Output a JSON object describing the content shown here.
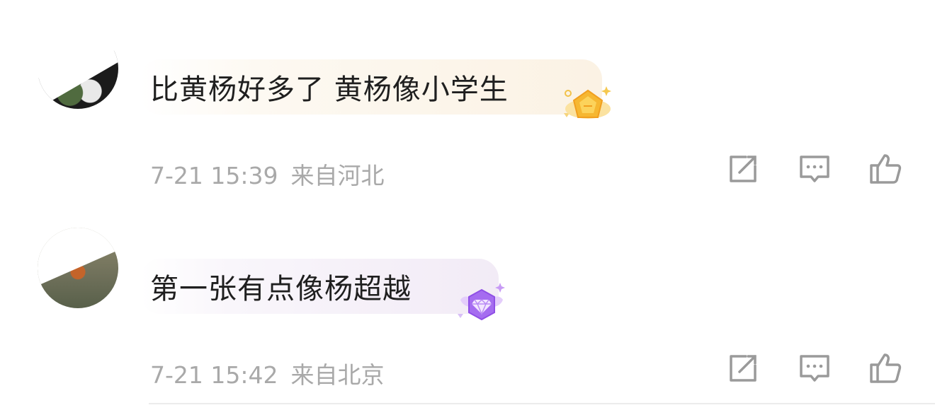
{
  "comments": [
    {
      "text": "比黄杨好多了 黄杨像小学生",
      "time": "7-21 15:39",
      "location": "来自河北",
      "badge": "gold-level-badge",
      "accent": "#f6b731"
    },
    {
      "text": "第一张有点像杨超越",
      "time": "7-21 15:42",
      "location": "来自北京",
      "badge": "diamond-level-badge",
      "accent": "#a56cf0"
    }
  ],
  "icons": {
    "share": "share-icon",
    "reply": "comment-icon",
    "like": "thumbs-up-icon"
  },
  "colors": {
    "text": "#1f1f1f",
    "meta": "#a9a9a9",
    "icon": "#9a9a9a"
  }
}
